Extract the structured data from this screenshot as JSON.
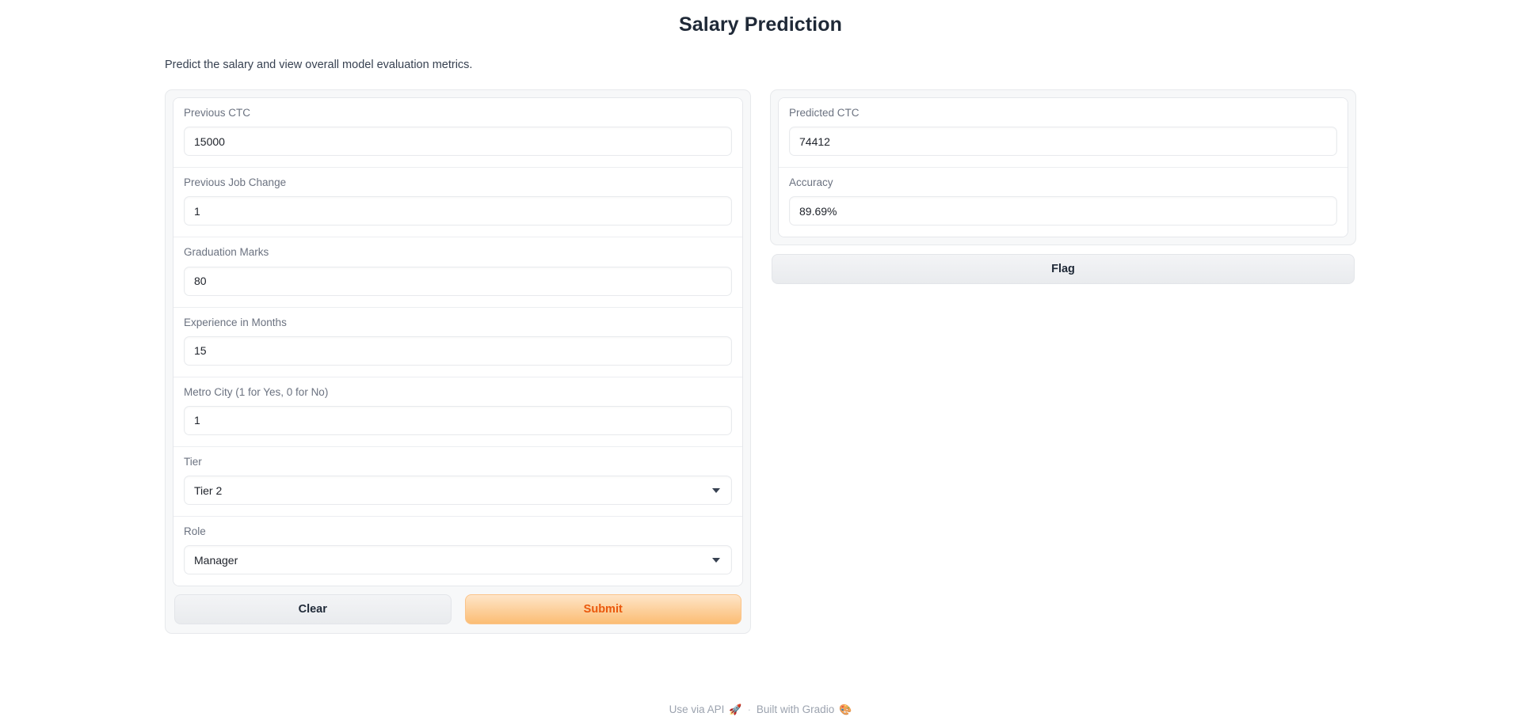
{
  "header": {
    "title": "Salary Prediction",
    "description": "Predict the salary and view overall model evaluation metrics."
  },
  "form": {
    "fields": [
      {
        "label": "Previous CTC",
        "value": "15000",
        "type": "number"
      },
      {
        "label": "Previous Job Change",
        "value": "1",
        "type": "number"
      },
      {
        "label": "Graduation Marks",
        "value": "80",
        "type": "number"
      },
      {
        "label": "Experience in Months",
        "value": "15",
        "type": "number"
      },
      {
        "label": "Metro City (1 for Yes, 0 for No)",
        "value": "1",
        "type": "number"
      },
      {
        "label": "Tier",
        "value": "Tier 2",
        "type": "dropdown"
      },
      {
        "label": "Role",
        "value": "Manager",
        "type": "dropdown"
      }
    ],
    "clear_label": "Clear",
    "submit_label": "Submit"
  },
  "output": {
    "fields": [
      {
        "label": "Predicted CTC",
        "value": "74412"
      },
      {
        "label": "Accuracy",
        "value": "89.69%"
      }
    ],
    "flag_label": "Flag"
  },
  "footer": {
    "use_via_api": "Use via API",
    "rocket_icon": "🚀",
    "separator": "·",
    "built_with": "Built with Gradio",
    "gradio_icon": "🎨"
  },
  "colors": {
    "title": "#1f2937",
    "label": "#6b7280",
    "value": "#20242c",
    "submit_text": "#ea580c",
    "submit_bg_start": "#fee5c8",
    "submit_bg_end": "#fbbd74",
    "panel_bg": "#f7f8f9",
    "border": "#e5e7eb"
  }
}
